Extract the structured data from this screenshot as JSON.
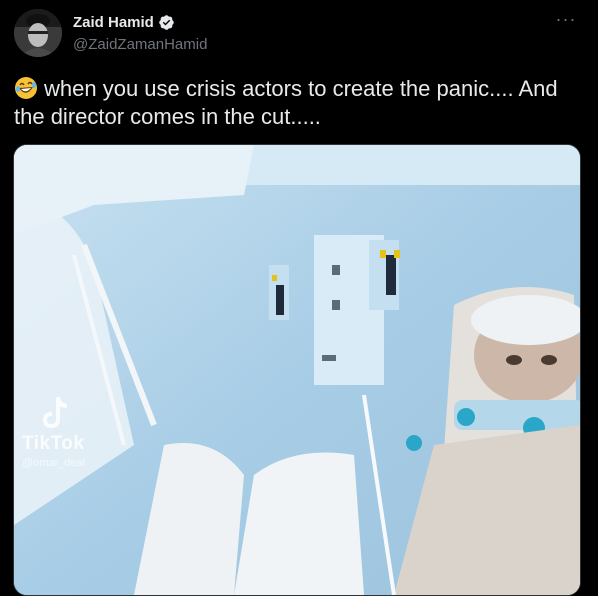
{
  "tweet": {
    "author_name": "Zaid Hamid",
    "handle": "@ZaidZamanHamid",
    "verified": true,
    "more_icon": "more-dots-icon",
    "emoji": "rolling-on-floor-laughing-emoji",
    "text": "when you use crisis actors to create the panic.... And the director comes in the cut.....",
    "media": {
      "type": "video",
      "watermark_brand": "TikTok",
      "watermark_user": "@omar_deal"
    }
  },
  "colors": {
    "background": "#000000",
    "text_primary": "#e7e9ea",
    "text_secondary": "#71767b",
    "verified_badge": "#e7e9ea"
  }
}
